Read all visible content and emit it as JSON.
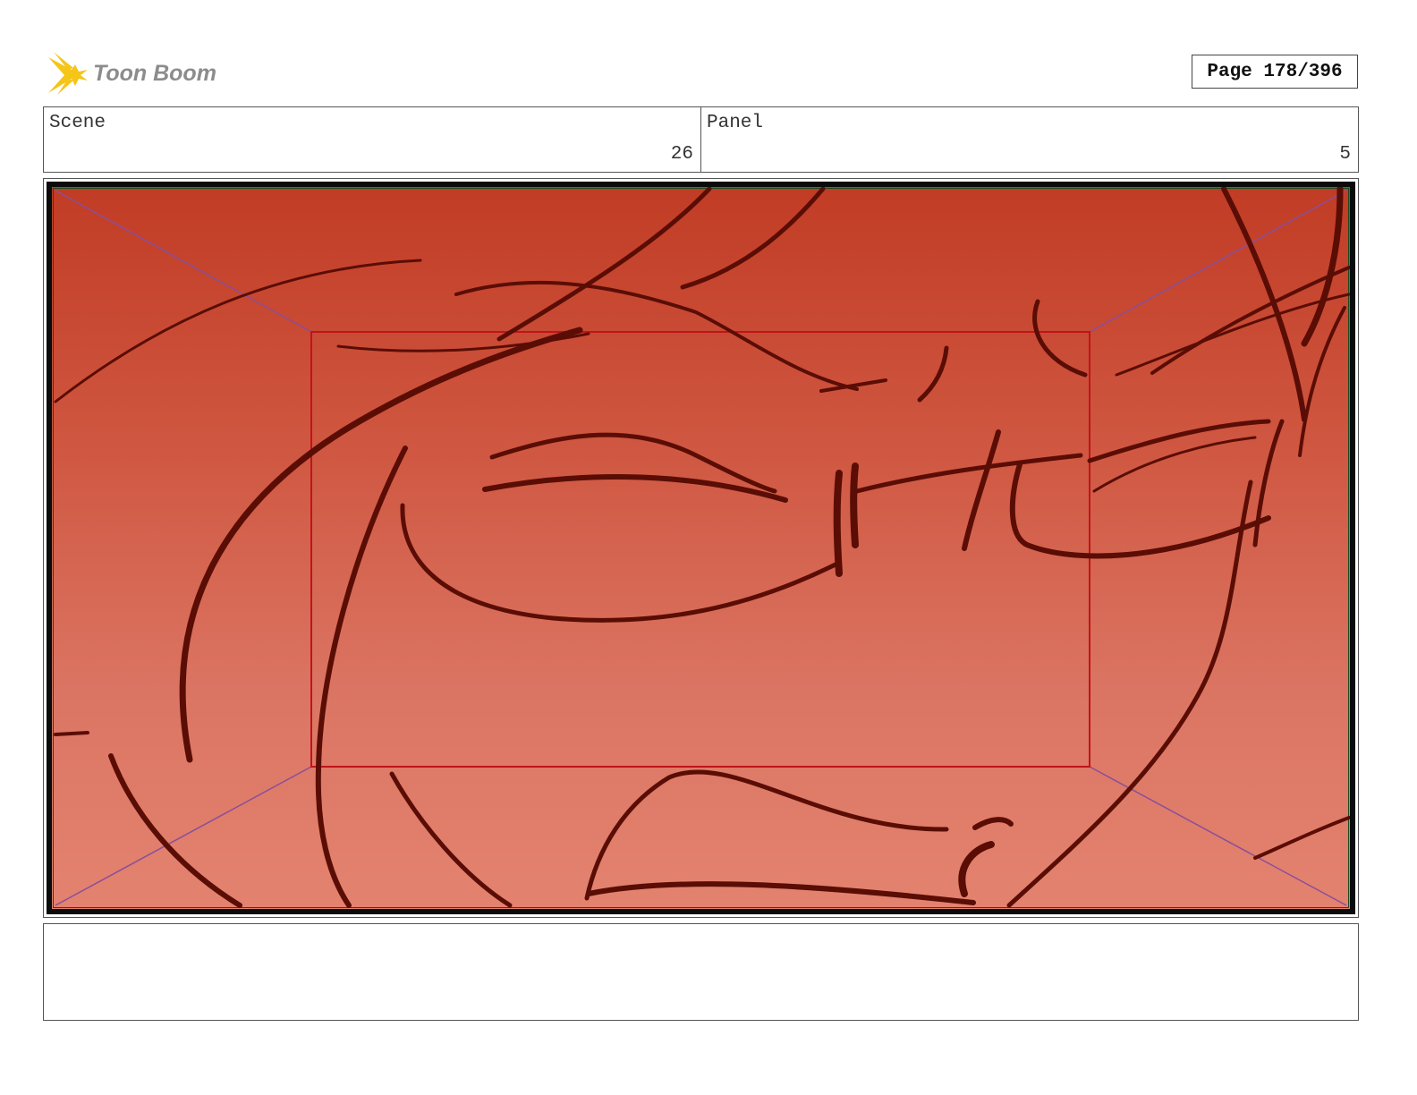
{
  "header": {
    "logo_text": "Toon Boom",
    "page_label": "Page 178/396"
  },
  "info": {
    "scene_label": "Scene",
    "scene_value": "26",
    "panel_label": "Panel",
    "panel_value": "5"
  },
  "colors": {
    "sketch_line": "#5a0d05",
    "camera_frame": "#c0141a",
    "field_guide": "#8a4e9a",
    "logo_yellow": "#f5c518",
    "logo_text": "#8c8c8c"
  },
  "caption": {
    "text": ""
  }
}
